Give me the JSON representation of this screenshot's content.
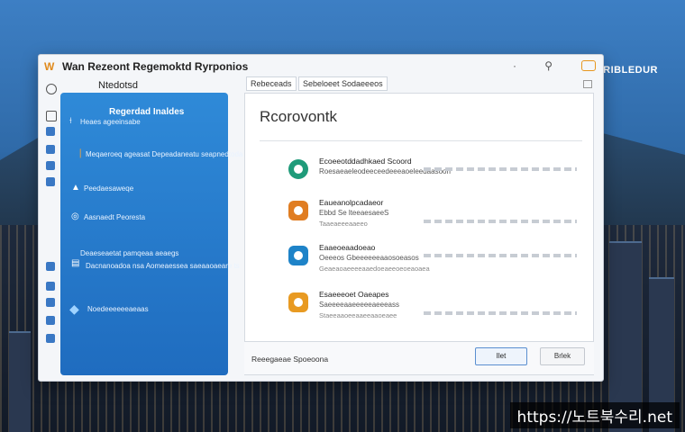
{
  "window": {
    "title": "Wan Rezeont Regemoktd Ryrponios",
    "left_header": "Ntedotsd",
    "brand": "ERIBLEDUR"
  },
  "left_panel": {
    "title": "Regerdad Inaldes",
    "items": [
      {
        "label": "Heaes ageeinsabe",
        "icon": "pin-icon"
      },
      {
        "label": "Meqaeroeq ageasat  Depeadaneatu seapnedtoda",
        "icon": "tag-icon"
      },
      {
        "label": "Peedaesaweqe",
        "icon": "cursor-icon"
      },
      {
        "label": "Aasnaedt  Peoresta",
        "icon": "info-icon"
      },
      {
        "label": "Deaeseaetat pamqeaa aeaegs",
        "icon": "list-icon"
      },
      {
        "label": "Dacnanoadoa  nsa Aomeaessea saeaaoaeare  ts",
        "icon": "file-icon"
      },
      {
        "label": "Noedeeeeeeaeaas",
        "icon": "diamond-icon"
      }
    ]
  },
  "tabs": [
    {
      "label": "Rebeceads"
    },
    {
      "label": "Sebeloeet  Sodaeeeos"
    }
  ],
  "main": {
    "title": "Rcorovontk",
    "steps": [
      {
        "name": "Ecoeeotddadhkaed Scoord",
        "desc": "Roesaeaeleodeeceedeeeaoeleedaasoon",
        "desc2": "",
        "color": "#1f9b7a"
      },
      {
        "name": "Eaueanolpcadaeor",
        "desc": "Ebbd  Se  lteeaesaeeS",
        "desc2": "Taaeaeeeaaeeo",
        "color": "#e07d22"
      },
      {
        "name": "Eaaeoeaadoeao",
        "desc": "Oeeeos  Gbeeeeeeaaosoeasos",
        "desc2": "Geaeaoaeeeeaaedoeaeeoeoeaoaea",
        "color": "#1e83c8"
      },
      {
        "name": "Esaeeeoet  Oaeapes",
        "desc": "Saeeeeaaeeeeeaeeeass",
        "desc2": "Staeeaaoeeaaeeaaoeaee",
        "color": "#e89a22"
      }
    ],
    "footer_text": "Reeegaeae Spoeoona",
    "primary_button": "Ilet",
    "secondary_button": "Brlek"
  },
  "watermark": "https://노트북수리.net"
}
